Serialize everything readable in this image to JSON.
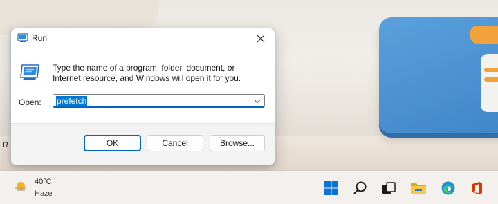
{
  "dialog": {
    "title": "Run",
    "description": "Type the name of a program, folder, document, or Internet resource, and Windows will open it for you.",
    "open_label": "Open:",
    "open_value": "prefetch",
    "buttons": {
      "ok": "OK",
      "cancel": "Cancel",
      "browse": "Browse..."
    }
  },
  "taskbar": {
    "weather": {
      "temp": "40°C",
      "condition": "Haze"
    },
    "icons": [
      "start-icon",
      "search-icon",
      "task-view-icon",
      "file-explorer-icon",
      "edge-icon",
      "office-icon"
    ]
  },
  "desktop": {
    "stray_char": "R"
  },
  "colors": {
    "accent": "#0078d4",
    "office": "#d83b01",
    "folder": "#f5c242",
    "wallpaper_blue": "#4a90d0"
  }
}
